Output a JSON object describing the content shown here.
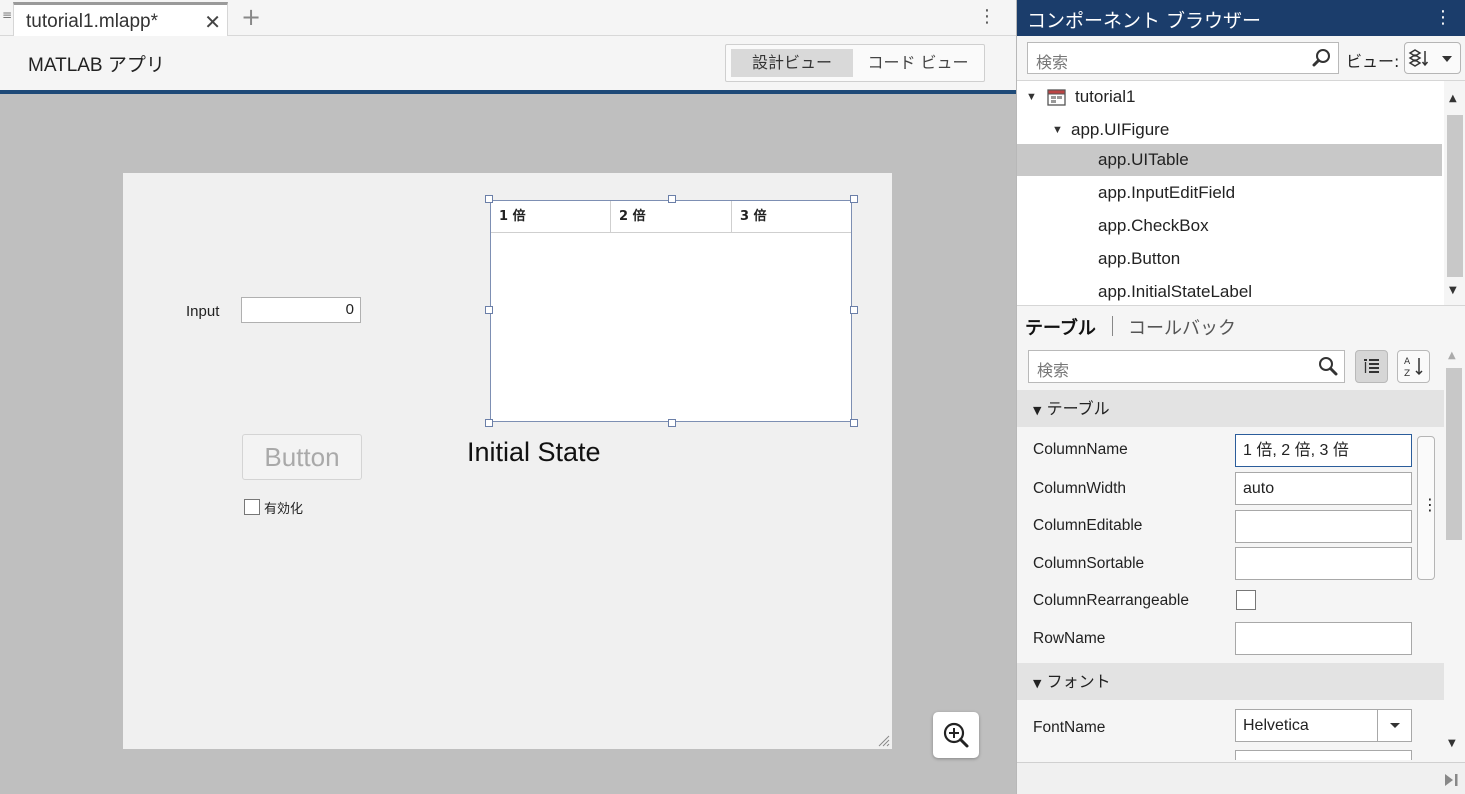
{
  "designer": {
    "tab_title": "tutorial1.mlapp*",
    "tab_close": "✕",
    "add_tab": "+",
    "app_title": "MATLAB アプリ",
    "view_design": "設計ビュー",
    "view_code": "コード ビュー",
    "canvas": {
      "input_label": "Input",
      "input_value": "0",
      "button_label": "Button",
      "checkbox_label": "有効化",
      "state_label": "Initial State",
      "table_columns": [
        "1 倍",
        "2 倍",
        "3 倍"
      ]
    }
  },
  "browser": {
    "title": "コンポーネント ブラウザー",
    "search_placeholder": "検索",
    "view_label": "ビュー:",
    "tree": [
      {
        "label": "tutorial1",
        "level": 0
      },
      {
        "label": "app.UIFigure",
        "level": 1
      },
      {
        "label": "app.UITable",
        "level": 2,
        "selected": true
      },
      {
        "label": "app.InputEditField",
        "level": 2
      },
      {
        "label": "app.CheckBox",
        "level": 2
      },
      {
        "label": "app.Button",
        "level": 2
      },
      {
        "label": "app.InitialStateLabel",
        "level": 2
      }
    ]
  },
  "inspector": {
    "tab_table": "テーブル",
    "tab_callback": "コールバック",
    "search_placeholder": "検索",
    "group_table": "テーブル",
    "group_font": "フォント",
    "props": {
      "column_name": {
        "label": "ColumnName",
        "value": "1 倍, 2 倍, 3 倍"
      },
      "column_width": {
        "label": "ColumnWidth",
        "value": "auto"
      },
      "column_editable": {
        "label": "ColumnEditable",
        "value": ""
      },
      "column_sortable": {
        "label": "ColumnSortable",
        "value": ""
      },
      "column_rearrangeable": {
        "label": "ColumnRearrangeable"
      },
      "row_name": {
        "label": "RowName",
        "value": ""
      },
      "font_name": {
        "label": "FontName",
        "value": "Helvetica"
      }
    }
  },
  "colors": {
    "header_blue": "#1b3d6b",
    "accent_rule": "#1e4a78",
    "selection": "#c8c8c8"
  }
}
